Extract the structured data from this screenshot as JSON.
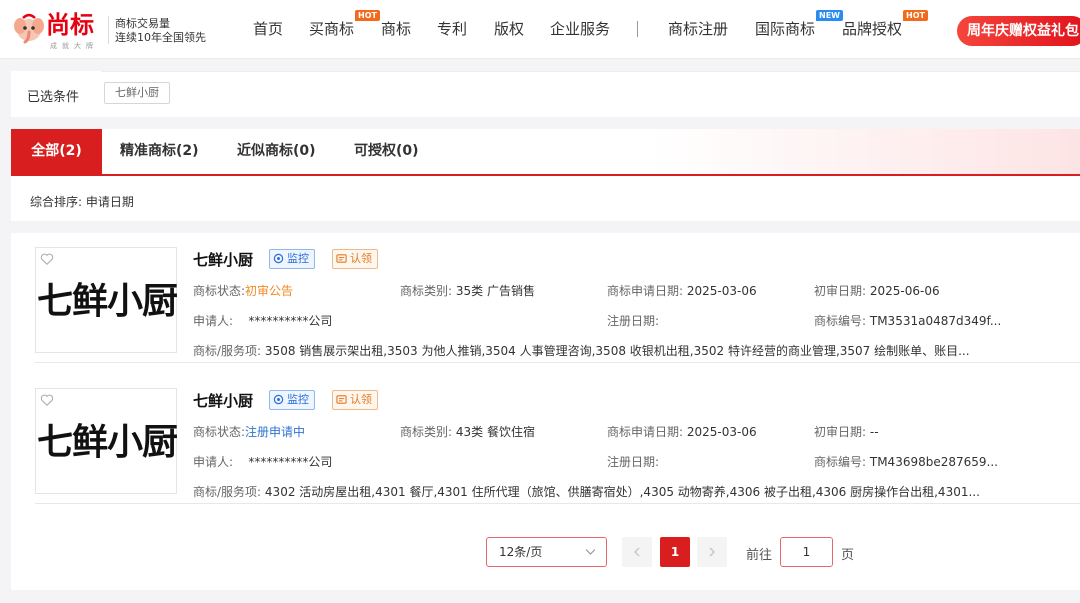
{
  "header": {
    "logo_name": "尚标",
    "logo_sub": "成就大牌",
    "slogan_line1": "商标交易量",
    "slogan_line2": "连续10年全国领先",
    "nav": [
      {
        "label": "首页"
      },
      {
        "label": "买商标",
        "badge": "HOT"
      },
      {
        "label": "商标"
      },
      {
        "label": "专利"
      },
      {
        "label": "版权"
      },
      {
        "label": "企业服务"
      },
      {
        "label": "商标注册"
      },
      {
        "label": "国际商标",
        "badge": "NEW"
      },
      {
        "label": "品牌授权",
        "badge": "HOT"
      }
    ],
    "promo": "周年庆赠权益礼包"
  },
  "filter": {
    "label": "已选条件",
    "chip": "七鲜小厨"
  },
  "tabs": [
    {
      "label": "全部(2)",
      "active": true
    },
    {
      "label": "精准商标(2)"
    },
    {
      "label": "近似商标(0)"
    },
    {
      "label": "可授权(0)"
    }
  ],
  "sort": {
    "label": "综合排序:",
    "value": "申请日期"
  },
  "labels": {
    "status": "商标状态:",
    "category": "商标类别:",
    "apply_date": "商标申请日期:",
    "prelim_date": "初审日期:",
    "applicant": "申请人:",
    "reg_date": "注册日期:",
    "reg_no": "商标编号:",
    "services": "商标/服务项:",
    "monitor": "监控",
    "claim": "认领"
  },
  "results": [
    {
      "name": "七鲜小厨",
      "image_text": "七鲜小厨",
      "status": "初审公告",
      "category": "35类 广告销售",
      "apply_date": "2025-03-06",
      "prelim_date": "2025-06-06",
      "applicant": "**********公司",
      "reg_date": "",
      "reg_no": "TM3531a0487d349f...",
      "services": "3508 销售展示架出租,3503 为他人推销,3504 人事管理咨询,3508 收银机出租,3502 特许经营的商业管理,3507 绘制账单、账目..."
    },
    {
      "name": "七鲜小厨",
      "image_text": "七鲜小厨",
      "status": "注册申请中",
      "category": "43类 餐饮住宿",
      "apply_date": "2025-03-06",
      "prelim_date": "--",
      "applicant": "**********公司",
      "reg_date": "",
      "reg_no": "TM43698be287659...",
      "services": "4302 活动房屋出租,4301 餐厅,4301 住所代理（旅馆、供膳寄宿处）,4305 动物寄养,4306 被子出租,4306 厨房操作台出租,4301..."
    }
  ],
  "pagination": {
    "page_size": "12条/页",
    "current_page": "1",
    "goto_label": "前往",
    "goto_value": "1",
    "page_unit": "页"
  },
  "colors": {
    "brand_red": "#d81e1e",
    "status_orange": "#f08a24",
    "status_blue": "#2f74d0"
  }
}
